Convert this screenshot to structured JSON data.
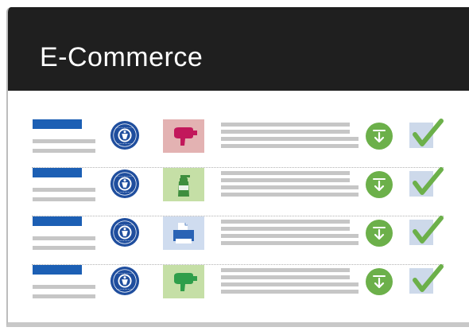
{
  "header": {
    "title": "E-Commerce"
  },
  "icons": {
    "seal": "blauer-engel-seal-icon",
    "download": "download-icon",
    "check": "checkmark-icon"
  },
  "colors": {
    "header_bg": "#1f1f1f",
    "name_block": "#1c5fb4",
    "seal_blue": "#1f4e9e",
    "download_green": "#6cb04a",
    "check_green": "#6cb04a",
    "check_bg": "#cdd9ea",
    "placeholder_gray": "#c6c6c6"
  },
  "products": [
    {
      "image": "hair-dryer-icon",
      "image_bg": "#e3b2b2",
      "image_fg": "#c2185b"
    },
    {
      "image": "spray-bottle-icon",
      "image_bg": "#c5dfa6",
      "image_fg": "#3e8e3e"
    },
    {
      "image": "printer-icon",
      "image_bg": "#cfdcef",
      "image_fg": "#2a63b5"
    },
    {
      "image": "hair-dryer-icon",
      "image_bg": "#c5dfa6",
      "image_fg": "#2f9e4a"
    }
  ]
}
